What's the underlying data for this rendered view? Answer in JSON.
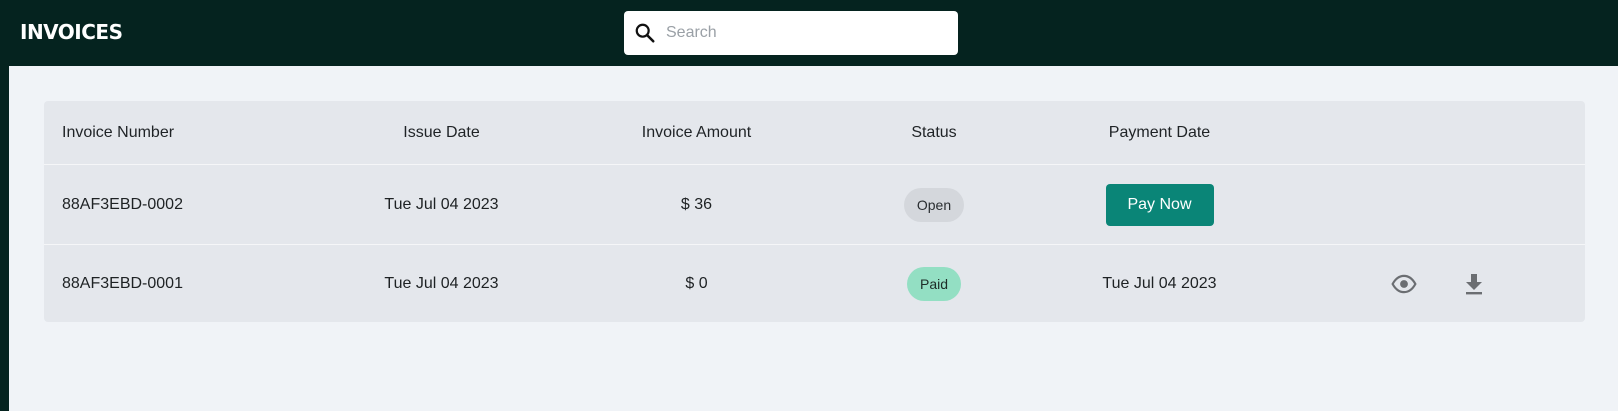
{
  "header": {
    "title": "INVOICES",
    "search_placeholder": "Search",
    "search_value": ""
  },
  "table": {
    "columns": {
      "invoice_number": "Invoice Number",
      "issue_date": "Issue Date",
      "invoice_amount": "Invoice Amount",
      "status": "Status",
      "payment_date": "Payment Date"
    },
    "rows": [
      {
        "invoice_number": "88AF3EBD-0002",
        "issue_date": "Tue Jul 04 2023",
        "invoice_amount": "$ 36",
        "status": "Open",
        "action_label": "Pay Now"
      },
      {
        "invoice_number": "88AF3EBD-0001",
        "issue_date": "Tue Jul 04 2023",
        "invoice_amount": "$ 0",
        "status": "Paid",
        "payment_date": "Tue Jul 04 2023",
        "icons": [
          "eye-icon",
          "download-icon"
        ]
      }
    ]
  },
  "colors": {
    "topbar": "#05231f",
    "background": "#f0f3f7",
    "table": "#e4e7ec",
    "primary_button": "#0a8577",
    "badge_open": "#d4d7dc",
    "badge_paid": "#93dfc3",
    "icon": "#6b6e72"
  }
}
